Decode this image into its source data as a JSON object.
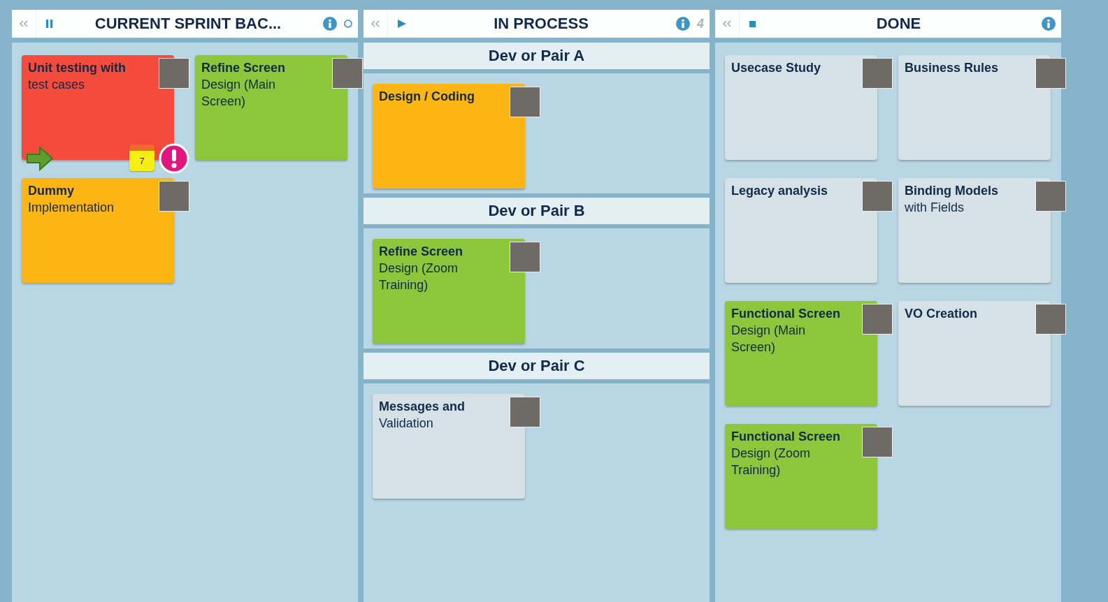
{
  "columns": [
    {
      "title": "CURRENT SPRINT BAC...",
      "kind": "pause",
      "extra": {
        "kind": "circle"
      },
      "cards": [
        {
          "title": "Unit testing with",
          "text": "test cases",
          "color": "#f44b3c",
          "arrow": true,
          "due": "7",
          "alert": true
        },
        {
          "title": "Refine Screen",
          "text": "Design (Main Screen)",
          "color": "#8cc63a"
        },
        {
          "title": "Dummy",
          "text": "Implementation",
          "color": "#fdb514"
        }
      ]
    },
    {
      "title": "IN PROCESS",
      "kind": "play",
      "extra": {
        "kind": "count",
        "text": "4"
      },
      "lanes": [
        {
          "name": "Dev or Pair A",
          "cards": [
            {
              "title": "Design / Coding",
              "color": "#fdb514"
            }
          ]
        },
        {
          "name": "Dev or Pair B",
          "cards": [
            {
              "title": "Refine Screen",
              "text": "Design (Zoom Training)",
              "color": "#8cc63a"
            }
          ]
        },
        {
          "name": "Dev or Pair C",
          "cards": [
            {
              "title": "Messages and",
              "text": "Validation",
              "color": "#d5e1e6"
            }
          ]
        }
      ]
    },
    {
      "title": "DONE",
      "kind": "stop",
      "cards": [
        {
          "title": "Usecase Study",
          "color": "#d5e1e6"
        },
        {
          "title": "Business Rules",
          "color": "#d5e1e6"
        },
        {
          "title": "Legacy analysis",
          "color": "#d5e1e6"
        },
        {
          "title": "Binding Models",
          "text": "with Fields",
          "color": "#d5e1e6"
        },
        {
          "title": "Functional Screen",
          "text": "Design (Main Screen)",
          "color": "#8cc63a"
        },
        {
          "title": "VO Creation",
          "color": "#d5e1e6"
        },
        {
          "title": "Functional Screen",
          "text": "Design (Zoom Training)",
          "color": "#8cc63a"
        }
      ]
    }
  ]
}
